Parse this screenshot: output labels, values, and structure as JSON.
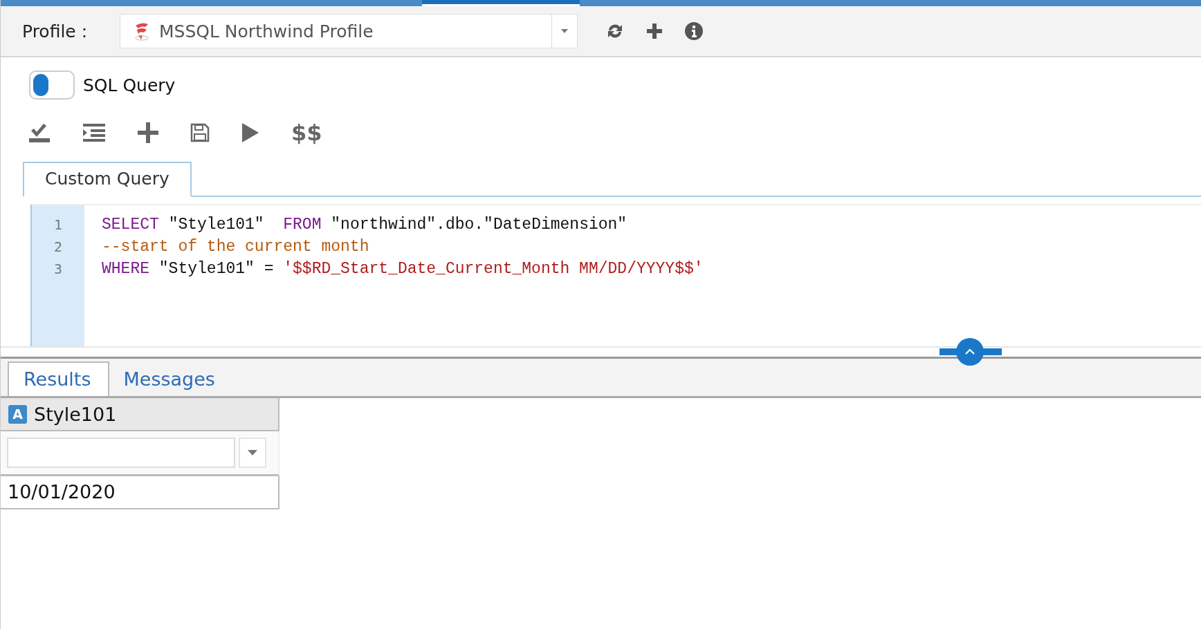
{
  "profile_bar": {
    "label": "Profile :",
    "profile": {
      "value": "MSSQL Northwind Profile"
    }
  },
  "query_toggle": {
    "label": "SQL Query",
    "on": false
  },
  "toolbar": [
    {
      "kind": "check"
    },
    {
      "kind": "indent"
    },
    {
      "kind": "add"
    },
    {
      "kind": "save"
    },
    {
      "kind": "run"
    },
    {
      "kind": "text",
      "label": "$$"
    }
  ],
  "editor_tabs": [
    {
      "label": "Custom Query",
      "selected": true
    }
  ],
  "editor": {
    "lines": [
      {
        "number": "1",
        "tokens": [
          {
            "kind": "keyword",
            "text": "SELECT"
          },
          {
            "kind": "plain",
            "text": " \"Style101\"  "
          },
          {
            "kind": "keyword",
            "text": "FROM"
          },
          {
            "kind": "plain",
            "text": " \"northwind\".dbo.\"DateDimension\""
          }
        ]
      },
      {
        "number": "2",
        "tokens": [
          {
            "kind": "comment",
            "text": "--start of the current month"
          }
        ]
      },
      {
        "number": "3",
        "tokens": [
          {
            "kind": "keyword",
            "text": "WHERE"
          },
          {
            "kind": "plain",
            "text": " \"Style101\" = "
          },
          {
            "kind": "string",
            "text": "'$$RD_Start_Date_Current_Month MM/DD/YYYY$$'"
          }
        ]
      }
    ]
  },
  "result_tabs": [
    {
      "label": "Results",
      "selected": true
    },
    {
      "label": "Messages",
      "selected": false
    }
  ],
  "table": {
    "columns": [
      {
        "type_badge": "A",
        "name": "Style101"
      }
    ],
    "rows": [
      [
        "10/01/2020"
      ]
    ]
  }
}
